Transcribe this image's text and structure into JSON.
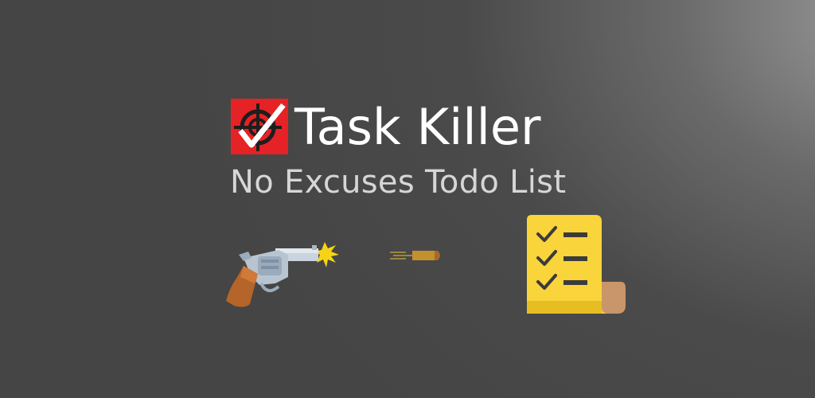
{
  "app": {
    "title": "Task Killer",
    "subtitle": "No Excuses Todo List"
  },
  "icons": {
    "logo": "target-check-icon",
    "gun": "revolver-icon",
    "bullet": "bullet-icon",
    "checklist": "checklist-icon"
  },
  "colors": {
    "logo_red": "#e52226",
    "title": "#ffffff",
    "subtitle": "#d6d6d6",
    "checklist_yellow": "#f9d43a"
  }
}
